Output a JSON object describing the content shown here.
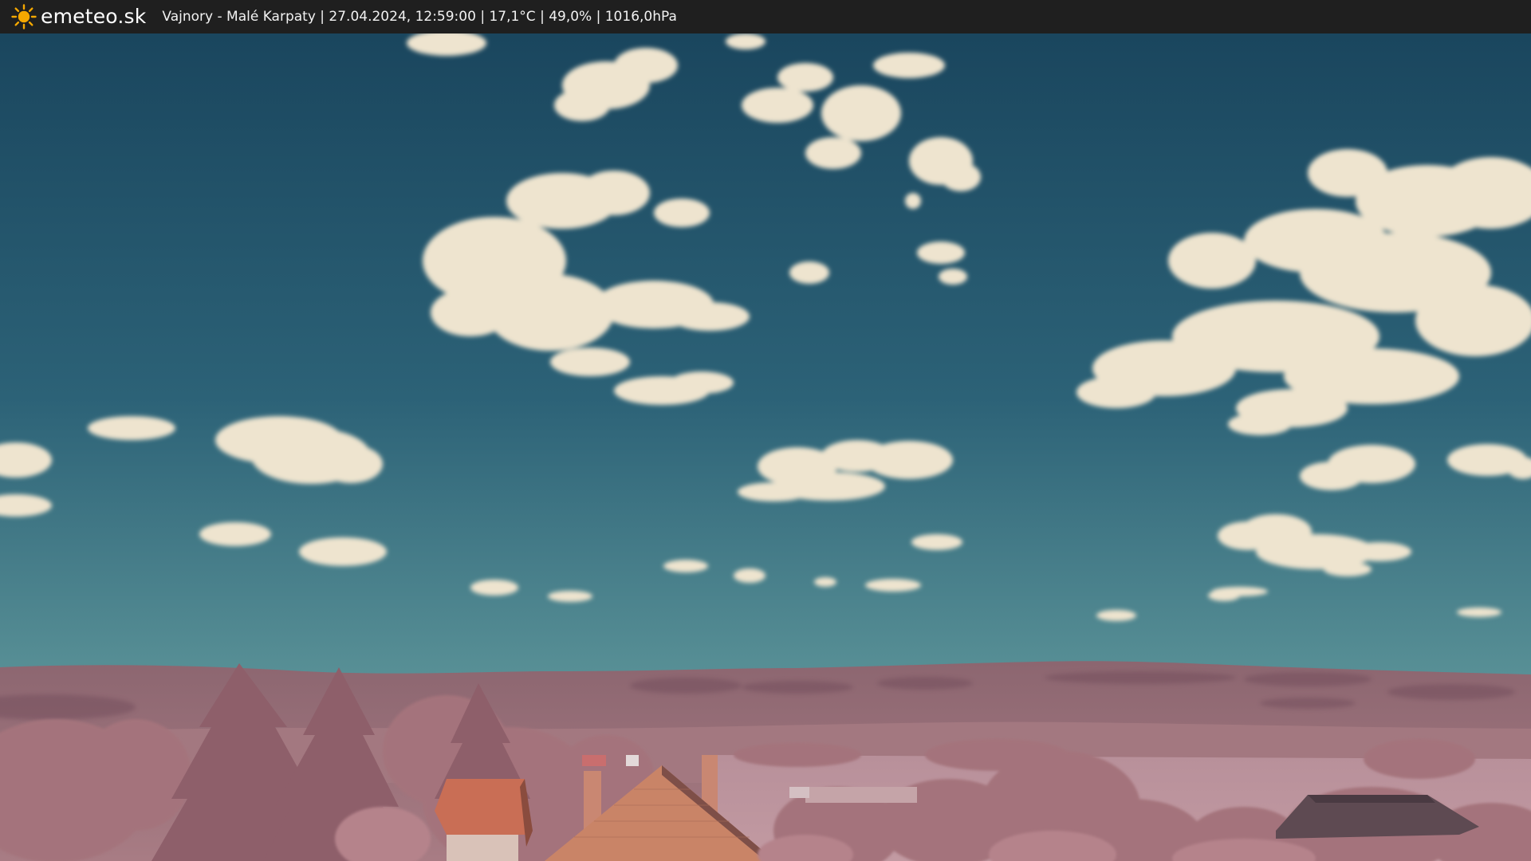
{
  "overlay": {
    "brand": "emeteo.sk",
    "caption": "Vajnory - Malé Karpaty | 27.04.2024, 12:59:00 | 17,1°C | 49,0% | 1016,0hPa",
    "logo_icon": "sun-icon",
    "logo_color": "#f5a800"
  },
  "scene": {
    "sky_top": "#1d4b62",
    "sky_horizon": "#4f8a93",
    "cloud_color": "#efe6d2",
    "hills_color": "#9c6f78",
    "foliage_color": "#b8868d",
    "roof_color": "#c96e55"
  }
}
